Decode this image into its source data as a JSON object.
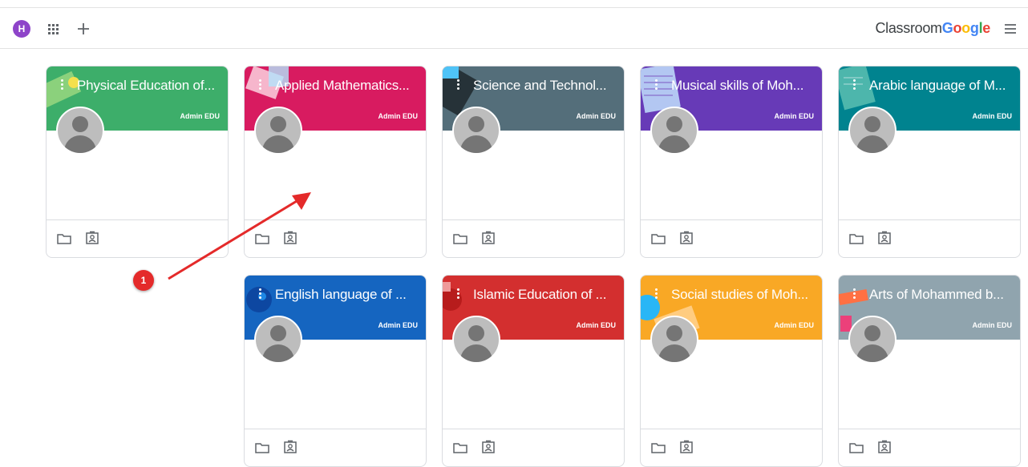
{
  "header": {
    "account_initial": "H",
    "brand_word": "Classroom",
    "brand_logo": [
      {
        "letter": "G",
        "color": "#4285F4"
      },
      {
        "letter": "o",
        "color": "#EA4335"
      },
      {
        "letter": "o",
        "color": "#FBBC05"
      },
      {
        "letter": "g",
        "color": "#4285F4"
      },
      {
        "letter": "l",
        "color": "#34A853"
      },
      {
        "letter": "e",
        "color": "#EA4335"
      }
    ],
    "icons": [
      "apps-icon",
      "add-icon",
      "menu-icon"
    ]
  },
  "classes": [
    {
      "title": "Physical Education of...",
      "owner": "Admin EDU",
      "color": "#3dae6a"
    },
    {
      "title": "Applied Mathematics...",
      "owner": "Admin EDU",
      "color": "#d81b60"
    },
    {
      "title": "Science and Technol...",
      "owner": "Admin EDU",
      "color": "#546e7a"
    },
    {
      "title": "Musical skills of Moh...",
      "owner": "Admin EDU",
      "color": "#673ab7"
    },
    {
      "title": "Arabic language of M...",
      "owner": "Admin EDU",
      "color": "#00838f"
    },
    {
      "title": "English language of ...",
      "owner": "Admin EDU",
      "color": "#1565c0"
    },
    {
      "title": "Islamic Education of ...",
      "owner": "Admin EDU",
      "color": "#d32f2f"
    },
    {
      "title": "Social studies of Moh...",
      "owner": "Admin EDU",
      "color": "#f9a825"
    },
    {
      "title": "Arts of Mohammed b...",
      "owner": "Admin EDU",
      "color": "#90a4ae"
    }
  ],
  "annotation": {
    "number": "1",
    "color": "#e42a2a"
  }
}
